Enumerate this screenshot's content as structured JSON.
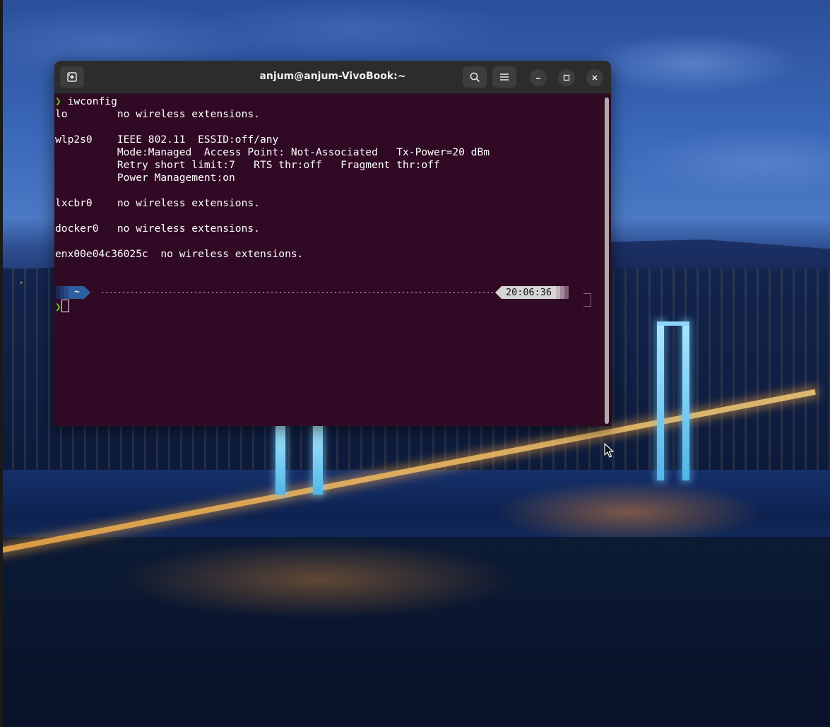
{
  "window": {
    "title": "anjum@anjum-VivoBook:~",
    "icons": {
      "new_tab": "new-tab-icon",
      "search": "search-icon",
      "menu": "hamburger-menu-icon",
      "minimize": "minimize-icon",
      "maximize": "maximize-icon",
      "close": "close-icon"
    }
  },
  "terminal": {
    "colors": {
      "background": "#300a24",
      "prompt": "#5ad21a",
      "dir_segment": "#2d5fa0",
      "time_segment": "#d6d6d6"
    },
    "prompt_symbol": "❯",
    "command": "iwconfig",
    "output": [
      "lo        no wireless extensions.",
      "",
      "wlp2s0    IEEE 802.11  ESSID:off/any",
      "          Mode:Managed  Access Point: Not-Associated   Tx-Power=20 dBm",
      "          Retry short limit:7   RTS thr:off   Fragment thr:off",
      "          Power Management:on",
      "",
      "lxcbr0    no wireless extensions.",
      "",
      "docker0   no wireless extensions.",
      "",
      "enx00e04c36025c  no wireless extensions."
    ],
    "powerline": {
      "directory": "~",
      "time": "20:06:36"
    }
  }
}
